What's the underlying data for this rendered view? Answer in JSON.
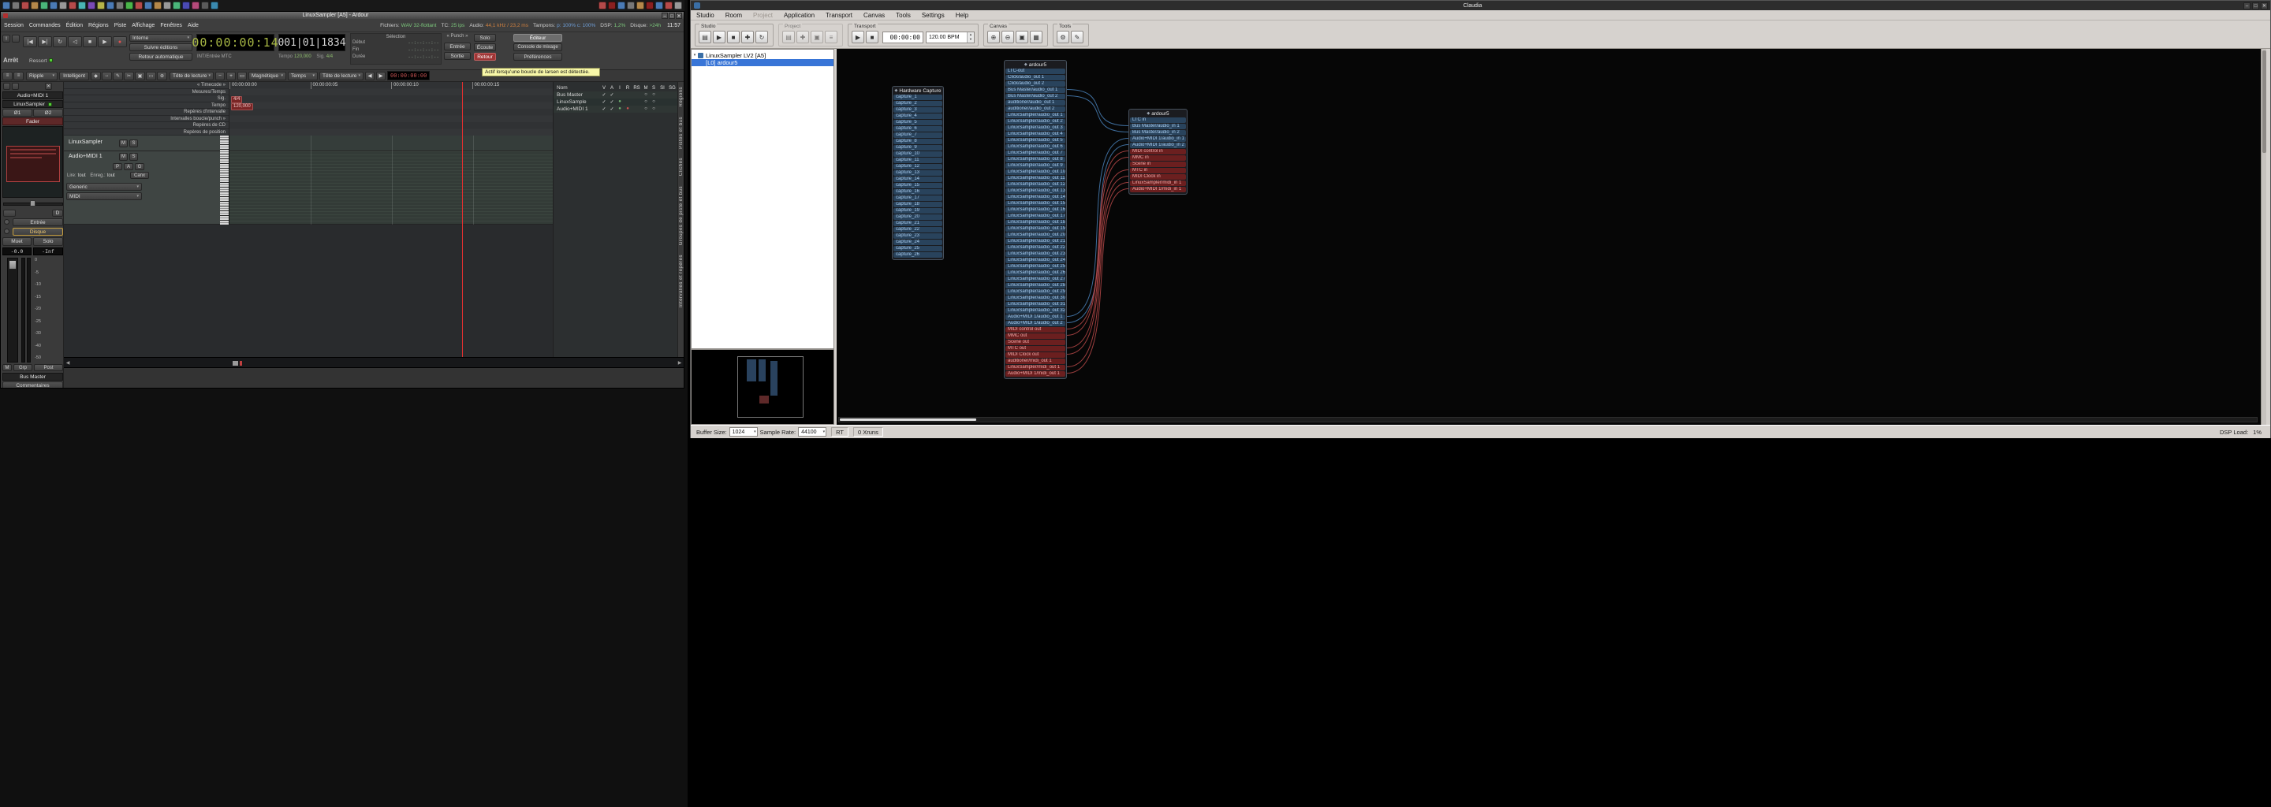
{
  "colors": {
    "audio_connection": "#4579ad",
    "midi_connection": "#ad4545",
    "audio_port": "#29435c",
    "midi_port": "#6b1f1f",
    "selection_blue": "#3875d7",
    "clock_digits": "#a8b845",
    "feedback_red": "#a03535"
  },
  "taskbar": {
    "left_icons": [
      {
        "color": "#4a7ab5"
      },
      {
        "color": "#777777"
      },
      {
        "color": "#b54a4a"
      },
      {
        "color": "#b5884a"
      },
      {
        "color": "#4ab57a"
      },
      {
        "color": "#4a7ab5"
      },
      {
        "color": "#999999"
      },
      {
        "color": "#b54a4a"
      },
      {
        "color": "#4ab5b5"
      },
      {
        "color": "#7a4ab5"
      },
      {
        "color": "#b5b54a"
      },
      {
        "color": "#4a7ab5"
      },
      {
        "color": "#777777"
      },
      {
        "color": "#4ab54a"
      },
      {
        "color": "#b54a4a"
      },
      {
        "color": "#4a7ab5"
      },
      {
        "color": "#b5884a"
      },
      {
        "color": "#999999"
      },
      {
        "color": "#4ab57a"
      },
      {
        "color": "#4a4ab5"
      },
      {
        "color": "#b54a7a"
      },
      {
        "color": "#5a5a5a"
      },
      {
        "color": "#3a8ab0"
      }
    ],
    "right_icons": [
      {
        "color": "#b54a4a"
      },
      {
        "color": "#8a2020"
      },
      {
        "color": "#4a7ab5"
      },
      {
        "color": "#777777"
      },
      {
        "color": "#b5884a"
      },
      {
        "color": "#8a2020"
      },
      {
        "color": "#4a7ab5"
      },
      {
        "color": "#b54a4a"
      },
      {
        "color": "#999999"
      }
    ]
  },
  "ardour": {
    "window_title": "LinuxSampler [A5] - Ardour",
    "window_buttons": [
      "–",
      "□",
      "✕"
    ],
    "menu": [
      "Session",
      "Commandes",
      "Édition",
      "Régions",
      "Piste",
      "Affichage",
      "Fenêtres",
      "Aide"
    ],
    "status": {
      "fichiers_label": "Fichiers:",
      "fichiers": "WAV 32-flottant",
      "tc_label": "TC:",
      "tc": "25 ips",
      "audio_label": "Audio:",
      "audio": "44,1 kHz / 23,2 ms",
      "tampons_label": "Tampons:",
      "tampons": "p: 100% c: 100%",
      "dsp_label": "DSP:",
      "dsp": "1,2%",
      "disque_label": "Disque:",
      "disque": ">24h",
      "horloge": "11:57"
    },
    "transport": {
      "panic": "!",
      "buttons": [
        {
          "label": "|◀",
          "name": "goto-start-button"
        },
        {
          "label": "▶|",
          "name": "goto-end-button"
        },
        {
          "label": "↻",
          "name": "loop-button"
        },
        {
          "label": "◁",
          "name": "play-selection-button"
        },
        {
          "label": "■",
          "name": "stop-button"
        },
        {
          "label": "▶",
          "name": "play-button"
        },
        {
          "label": "●",
          "name": "record-button",
          "class": "rec"
        }
      ],
      "etat": "Arrêt",
      "ressort": "Ressort",
      "sync": "Interne",
      "follow": "Suivre éditions",
      "auto_return": "Retour automatique",
      "sync_info": "INT/Entrée MTC",
      "primary_clock": "00:00:00:14",
      "secondary_clock": "001|01|1834",
      "tempo_label": "Tempo",
      "tempo": "120,000",
      "sig_label": "Sig.",
      "sig": "4/4",
      "selection_label": "Sélection",
      "sel_rows": [
        {
          "label": "Début",
          "value": "--:--:--:--"
        },
        {
          "label": "Fin",
          "value": "--:--:--:--"
        },
        {
          "label": "Durée",
          "value": "--:--:--:--"
        }
      ],
      "punch_label": "« Punch »",
      "punch_in": "Entrée",
      "punch_out": "Sortie",
      "solo": "Solo",
      "ecoute": "Écoute",
      "retour": "Retour",
      "editeur": "Éditeur",
      "console": "Console de mixage",
      "preferences": "Préférences",
      "tooltip": "Actif lorsqu'une boucle de larsen est détectée."
    },
    "edit_toolbar": {
      "left_btns": [
        "≡",
        "≡"
      ],
      "edit_mode": "Ripple",
      "smart": "Intelligent",
      "tools": [
        "◆",
        "↔",
        "✎",
        "✂",
        "▣",
        "▭",
        "⊕"
      ],
      "playhead": "Tête de lecture",
      "zoom_out": "−",
      "zoom_in": "+",
      "zoom_fit": "▭",
      "snap": "Magnétique",
      "grid": "Temps",
      "playhead2": "Tête de lecture",
      "nudge_back": "◀",
      "nudge_fwd": "▶",
      "clock": "00:00:00:00"
    },
    "rulers": [
      "« Timecode »",
      "Mesures/Temps",
      "Sig.",
      "Tempo",
      "Repères d'intervalle",
      "Intervalles boucle/punch »",
      "Repères de CD",
      "Repères de position"
    ],
    "ruler_values": {
      "sig": "4/4",
      "tempo": "120,000"
    },
    "timeline_ticks": [
      "00:00:00:00",
      "00:00:00:05",
      "00:00:00:10",
      "00:00:00:15"
    ],
    "tracks": [
      {
        "name": "LinuxSampler",
        "mute": "M",
        "solo": "S"
      },
      {
        "name": "Audio+MIDI 1",
        "mute": "M",
        "solo": "S",
        "pag": [
          "P",
          "A",
          "G"
        ],
        "lire_label": "Lire:",
        "lire": "tout",
        "enreg_label": "Enreg.:",
        "enreg": "tout",
        "canx": "Canx",
        "combo1": "Generic",
        "combo2": "MIDI"
      }
    ],
    "route_list": {
      "name_col": "Nom",
      "cols": [
        "V",
        "A",
        "I",
        "R",
        "RS",
        "M",
        "S",
        "SI",
        "SG"
      ],
      "rows": [
        {
          "name": "Bus Master",
          "cells": [
            "✓",
            "✓",
            "",
            "",
            "",
            "○",
            "○",
            "",
            ""
          ]
        },
        {
          "name": "LinuxSample",
          "cells": [
            "✓",
            "✓",
            {
              "label": "●",
              "class": "grn"
            },
            "",
            "",
            "○",
            "○",
            "",
            ""
          ]
        },
        {
          "name": "Audio+MIDI 1",
          "cells": [
            "✓",
            "✓",
            {
              "label": "●",
              "class": "grn"
            },
            {
              "label": "●",
              "class": "red"
            },
            "",
            "○",
            "○",
            "",
            ""
          ]
        }
      ]
    },
    "side_tabs": [
      "Régions",
      "Pistes et bus",
      "Clichés",
      "Groupes de piste et bus",
      "Intervalles et repères"
    ],
    "mixer": {
      "close": "✕",
      "name_top": "Audio+MIDI 1",
      "name2": "LinuxSampler",
      "phase1": "Ø1",
      "phase2": "Ø2",
      "fader_label": "Fader",
      "d_button": "D",
      "entree": "Entrée",
      "disque": "Disque",
      "muet": "Muet",
      "solo": "Solo",
      "gain": "-0.0",
      "peak": "-Inf",
      "meter_marks": [
        "0",
        "-5",
        "-10",
        "-15",
        "-20",
        "-25",
        "-30",
        "-40",
        "-50"
      ],
      "m": "M",
      "grp": "Grp",
      "post": "Post",
      "output": "Bus Master",
      "comments": "Commentaires"
    },
    "summary": {
      "prev": "◀",
      "next": "▶"
    }
  },
  "claudia": {
    "window_title": "Claudia",
    "window_buttons": [
      "–",
      "□",
      "✕"
    ],
    "menu": [
      "Studio",
      "Room",
      {
        "label": "Project",
        "class": "disabled"
      },
      "Application",
      "Transport",
      "Canvas",
      "Tools",
      "Settings",
      "Help"
    ],
    "toolbar": {
      "studio": {
        "label": "Studio",
        "icons": [
          "▤",
          "▶",
          "■",
          "✚",
          "↻"
        ]
      },
      "project": {
        "label": "Project",
        "icons": [
          "▤",
          "✚",
          "▣",
          "≡"
        ]
      },
      "transport": {
        "label": "Transport",
        "icons": [
          "▶",
          "■"
        ],
        "time": "00:00:00",
        "bpm": "120.00 BPM"
      },
      "canvas": {
        "label": "Canvas",
        "icons": [
          "⊕",
          "⊖",
          "▣",
          "▦"
        ]
      },
      "tools": {
        "label": "Tools",
        "icons": [
          "⚙",
          "✎"
        ]
      }
    },
    "tree": {
      "expander": "▾",
      "root": "LinuxSampler LV2 [A5]",
      "child": "[L0] ardour5"
    },
    "canvas": {
      "hardware_capture": {
        "title": "Hardware Capture",
        "ports": [
          "capture_1",
          "capture_2",
          "capture_3",
          "capture_4",
          "capture_5",
          "capture_6",
          "capture_7",
          "capture_8",
          "capture_9",
          "capture_10",
          "capture_11",
          "capture_12",
          "capture_13",
          "capture_14",
          "capture_15",
          "capture_16",
          "capture_17",
          "capture_18",
          "capture_19",
          "capture_20",
          "capture_21",
          "capture_22",
          "capture_23",
          "capture_24",
          "capture_25",
          "capture_26"
        ]
      },
      "ardour_out": {
        "title": "ardour5",
        "audio_ports": [
          "LTC-out",
          "Click/audio_out 1",
          "Click/audio_out 2",
          "Bus Master/audio_out 1",
          "Bus Master/audio_out 2",
          "auditioner/audio_out 1",
          "auditioner/audio_out 2",
          "LinuxSampler/audio_out 1",
          "LinuxSampler/audio_out 2",
          "LinuxSampler/audio_out 3",
          "LinuxSampler/audio_out 4",
          "LinuxSampler/audio_out 5",
          "LinuxSampler/audio_out 6",
          "LinuxSampler/audio_out 7",
          "LinuxSampler/audio_out 8",
          "LinuxSampler/audio_out 9",
          "LinuxSampler/audio_out 10",
          "LinuxSampler/audio_out 11",
          "LinuxSampler/audio_out 12",
          "LinuxSampler/audio_out 13",
          "LinuxSampler/audio_out 14",
          "LinuxSampler/audio_out 15",
          "LinuxSampler/audio_out 16",
          "LinuxSampler/audio_out 17",
          "LinuxSampler/audio_out 18",
          "LinuxSampler/audio_out 19",
          "LinuxSampler/audio_out 20",
          "LinuxSampler/audio_out 21",
          "LinuxSampler/audio_out 22",
          "LinuxSampler/audio_out 23",
          "LinuxSampler/audio_out 24",
          "LinuxSampler/audio_out 25",
          "LinuxSampler/audio_out 26",
          "LinuxSampler/audio_out 27",
          "LinuxSampler/audio_out 28",
          "LinuxSampler/audio_out 29",
          "LinuxSampler/audio_out 30",
          "LinuxSampler/audio_out 31",
          "LinuxSampler/audio_out 32",
          "Audio+MIDI 1/audio_out 1",
          "Audio+MIDI 1/audio_out 2"
        ],
        "midi_ports": [
          "MIDI control out",
          "MMC out",
          "Scene out",
          "MTC out",
          "MIDI Clock out",
          "auditioner/midi_out 1",
          "LinuxSampler/midi_out 1",
          "Audio+MIDI 1/midi_out 1"
        ]
      },
      "ardour_in": {
        "title": "ardour5",
        "audio_ports": [
          "LTC in",
          "Bus Master/audio_in 1",
          "Bus Master/audio_in 2",
          "Audio+MIDI 1/audio_in 1",
          "Audio+MIDI 1/audio_in 2"
        ],
        "midi_ports": [
          "MIDI control in",
          "MMC in",
          "Scene in",
          "MTC in",
          "MIDI Clock in",
          "LinuxSampler/midi_in 1",
          "Audio+MIDI 1/midi_in 1"
        ]
      }
    },
    "statusbar": {
      "buffer_label": "Buffer Size:",
      "buffer": "1024",
      "rate_label": "Sample Rate:",
      "rate": "44100",
      "rt": "RT",
      "xruns": "0 Xruns",
      "dsp_label": "DSP Load:",
      "dsp": "1%"
    }
  }
}
